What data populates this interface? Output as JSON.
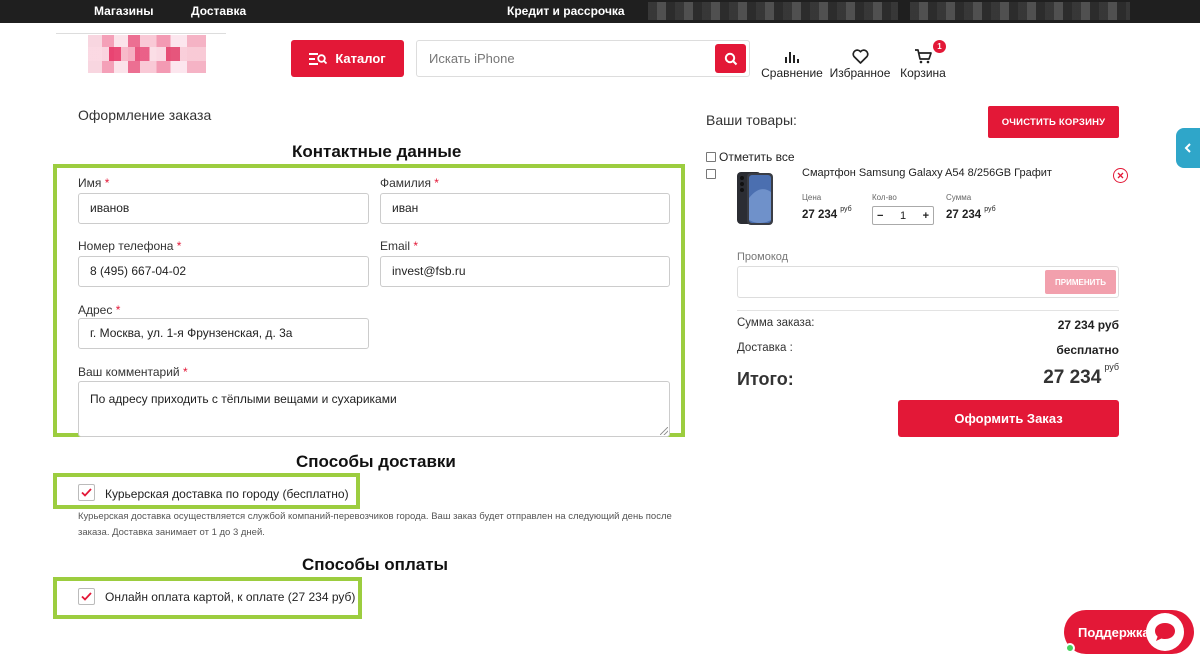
{
  "topbar": {
    "links": [
      "Магазины",
      "Доставка"
    ],
    "center": "Кредит и рассрочка"
  },
  "header": {
    "catalog_label": "Каталог",
    "search_placeholder": "Искать iPhone",
    "compare_label": "Сравнение",
    "favorites_label": "Избранное",
    "cart_label": "Корзина",
    "cart_count": "1"
  },
  "order": {
    "page_title": "Оформление заказа",
    "contact_title": "Контактные данные",
    "fields": {
      "name_label": "Имя",
      "name_value": "иванов",
      "surname_label": "Фамилия",
      "surname_value": "иван",
      "phone_label": "Номер телефона",
      "phone_value": "8 (495) 667-04-02",
      "email_label": "Email",
      "email_value": "invest@fsb.ru",
      "address_label": "Адрес",
      "address_value": "г. Москва, ул. 1-я Фрунзенская, д. 3а",
      "comment_label": "Ваш комментарий",
      "comment_value": "По адресу приходить с тёплыми вещами и сухариками",
      "required_mark": "*"
    },
    "delivery_title": "Способы доставки",
    "delivery_option": "Курьерская доставка по городу (бесплатно)",
    "delivery_note": "Курьерская доставка осуществляется службой компаний-перевозчиков города. Ваш заказ будет отправлен на следующий день после заказа. Доставка занимает от 1 до 3 дней.",
    "payment_title": "Способы оплаты",
    "payment_option": "Онлайн оплата картой, к оплате (27 234 руб)"
  },
  "cart": {
    "title": "Ваши товары:",
    "clear_label": "ОЧИСТИТЬ КОРЗИНУ",
    "mark_all": "Отметить все",
    "item": {
      "name": "Смартфон Samsung Galaxy A54 8/256GB Графит",
      "price_label": "Цена",
      "price": "27 234",
      "currency": "руб",
      "qty_label": "Кол-во",
      "qty": "1",
      "sum_label": "Сумма",
      "sum": "27 234"
    },
    "promo_label": "Промокод",
    "apply_label": "ПРИМЕНИТЬ",
    "order_sum_label": "Сумма заказа:",
    "order_sum": "27 234 руб",
    "delivery_label": "Доставка :",
    "delivery_value": "бесплатно",
    "total_label": "Итого:",
    "total": "27 234",
    "total_currency": "руб",
    "checkout_label": "Оформить Заказ"
  },
  "support": {
    "label": "Поддержка"
  },
  "colors": {
    "accent": "#e31837",
    "highlight": "#9ccd3f",
    "side_tab": "#2fa6c9"
  }
}
